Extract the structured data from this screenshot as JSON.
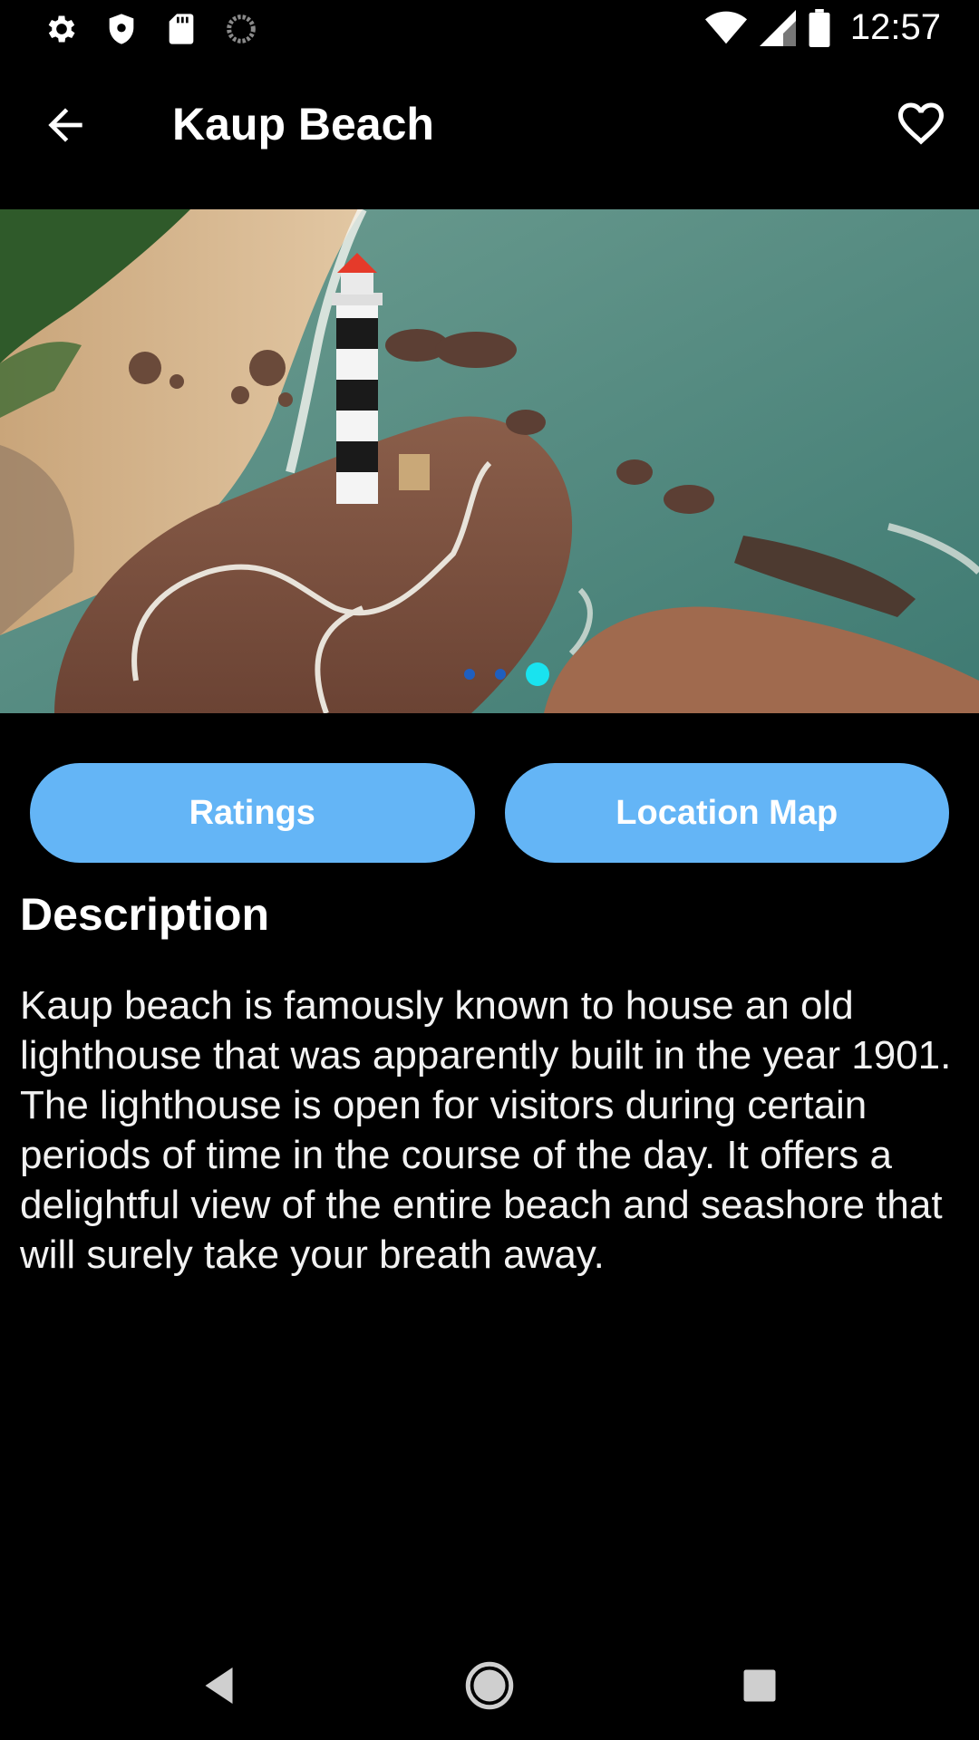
{
  "status_bar": {
    "time": "12:57",
    "left_icons": [
      "gear-icon",
      "shield-icon",
      "sd-card-icon",
      "sync-icon"
    ],
    "right_icons": [
      "wifi-icon",
      "cell-signal-icon",
      "battery-icon"
    ]
  },
  "app_bar": {
    "title": "Kaup Beach",
    "back_icon": "arrow-left-icon",
    "favorite_icon": "heart-outline-icon"
  },
  "carousel": {
    "image": "photo of Kaup Beach lighthouse",
    "page_count": 3,
    "active_page": 3,
    "colors": {
      "dot_inactive": "#1f5fbf",
      "dot_active": "#19e3ef"
    }
  },
  "buttons": {
    "ratings_label": "Ratings",
    "location_map_label": "Location Map",
    "color": "#64b5f6"
  },
  "description": {
    "heading": "Description",
    "text": "Kaup beach is famously known to house an old lighthouse that was apparently built in the year 1901. The lighthouse is open for visitors during certain periods of time in the course of the day. It offers a delightful view of the entire beach and seashore that will surely take your breath away."
  },
  "nav_bar": {
    "icons": [
      "back-triangle-icon",
      "home-circle-icon",
      "recents-square-icon"
    ]
  }
}
